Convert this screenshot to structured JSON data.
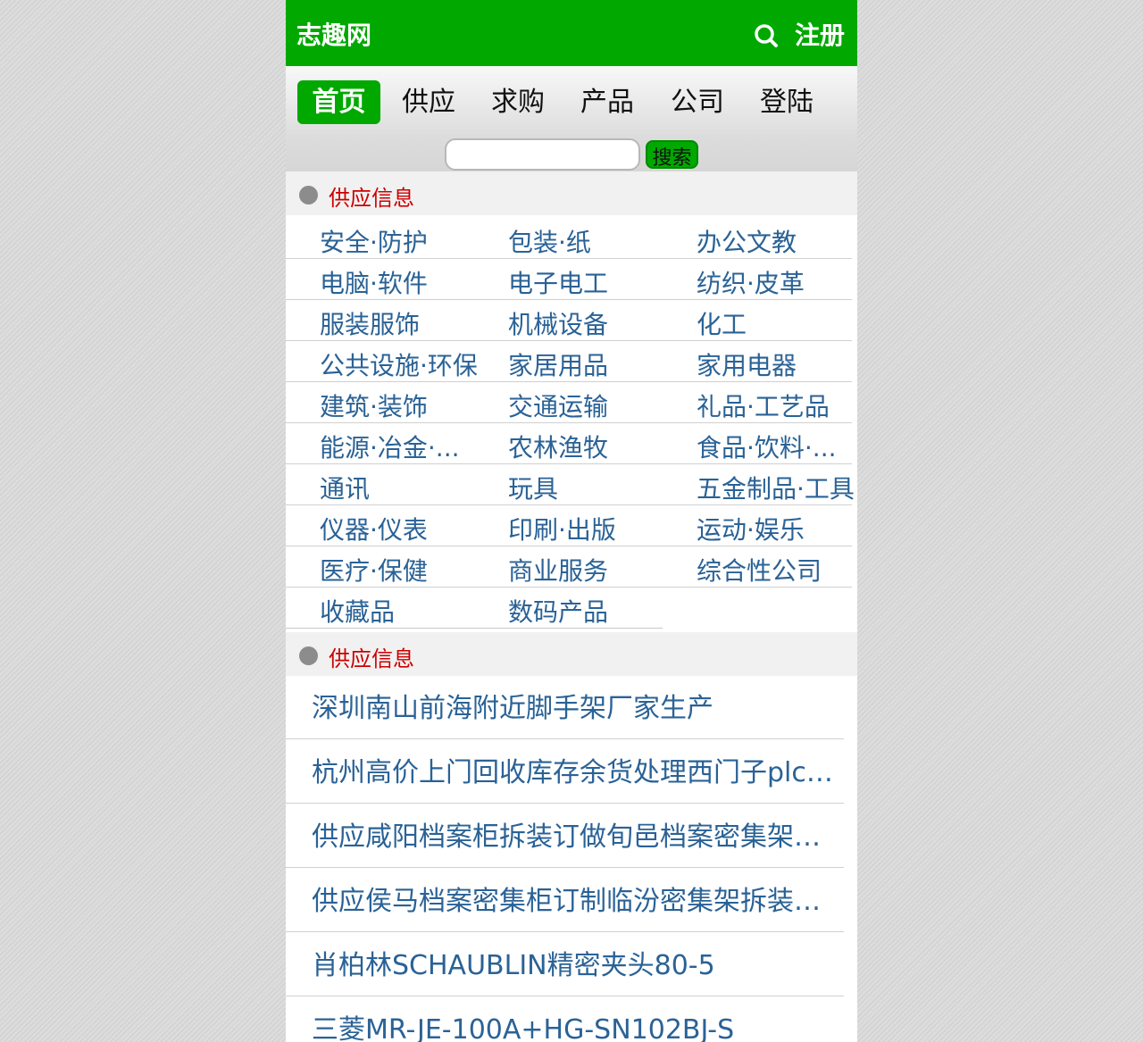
{
  "header": {
    "logo": "志趣网",
    "register": "注册"
  },
  "nav": [
    "首页",
    "供应",
    "求购",
    "产品",
    "公司",
    "登陆"
  ],
  "search": {
    "placeholder": "",
    "button": "搜索"
  },
  "sections": [
    {
      "title": "供应信息"
    },
    {
      "title": "供应信息"
    }
  ],
  "categories": [
    [
      "安全·防护",
      "包装·纸",
      "办公文教"
    ],
    [
      "电脑·软件",
      "电子电工",
      "纺织·皮革"
    ],
    [
      "服装服饰",
      "机械设备",
      "化工"
    ],
    [
      "公共设施·环保",
      "家居用品",
      "家用电器"
    ],
    [
      "建筑·装饰",
      "交通运输",
      "礼品·工艺品"
    ],
    [
      "能源·冶金·...",
      "农林渔牧",
      "食品·饮料·..."
    ],
    [
      "通讯",
      "玩具",
      "五金制品·工具"
    ],
    [
      "仪器·仪表",
      "印刷·出版",
      "运动·娱乐"
    ],
    [
      "医疗·保健",
      "商业服务",
      "综合性公司"
    ],
    [
      "收藏品",
      "数码产品",
      ""
    ]
  ],
  "supply_list": [
    "深圳南山前海附近脚手架厂家生产",
    "杭州高价上门回收库存余货处理西门子plc模块",
    "供应咸阳档案柜拆装订做旬邑档案密集架搬迁",
    "供应侯马档案密集柜订制临汾密集架拆装搬迁",
    "肖柏林SCHAUBLIN精密夹头80-5",
    "三菱MR-JE-100A+HG-SN102BJ-S"
  ],
  "colors": {
    "brand_green": "#00a800",
    "link_blue": "#2a6296",
    "section_red": "#cc0000"
  }
}
